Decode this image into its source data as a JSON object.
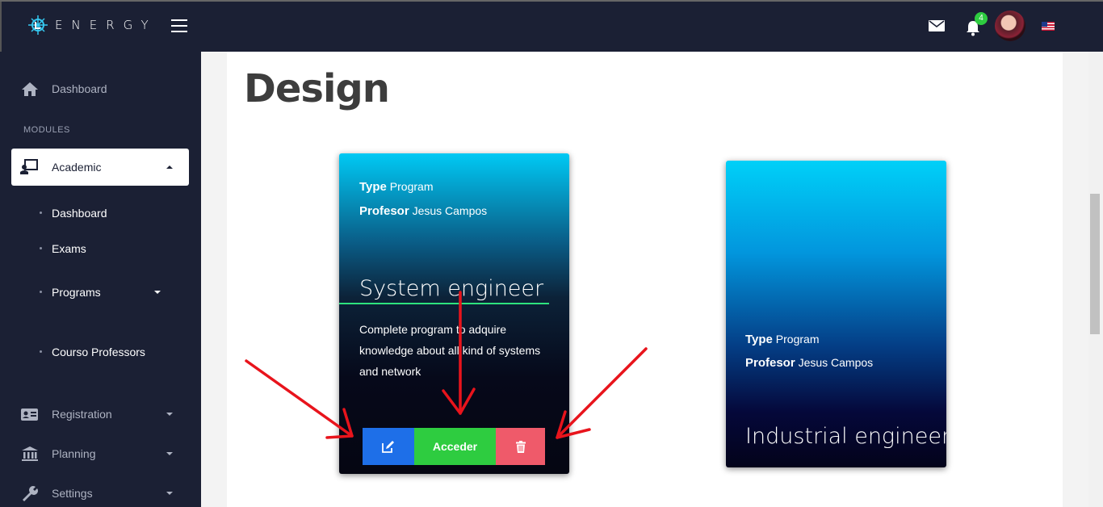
{
  "topbar": {
    "brand": "ENERGY",
    "notification_count": "4"
  },
  "sidebar": {
    "dashboard_label": "Dashboard",
    "modules_header": "MODULES",
    "academic_label": "Academic",
    "academic_subitems": [
      {
        "label": "Dashboard"
      },
      {
        "label": "Exams"
      },
      {
        "label": "Programs"
      },
      {
        "label": "Courso Professors"
      }
    ],
    "registration_label": "Registration",
    "planning_label": "Planning",
    "settings_label": "Settings"
  },
  "main": {
    "page_title": "Design",
    "cards": [
      {
        "type_label": "Type",
        "type_value": "Program",
        "professor_label": "Profesor",
        "professor_value": "Jesus Campos",
        "title": "System engineer",
        "description": "Complete program to adquire knowledge about all kind of systems and network",
        "access_button": "Acceder"
      },
      {
        "type_label": "Type",
        "type_value": "Program",
        "professor_label": "Profesor",
        "professor_value": "Jesus Campos",
        "title": "Industrial engineer"
      }
    ]
  },
  "colors": {
    "sidebar_bg": "#1b2034",
    "edit_button": "#1e6fe8",
    "access_button": "#2ecc40",
    "delete_button": "#ef5a6a",
    "title_underline": "#2ee37e",
    "annotation_arrows": "#e8141c"
  },
  "icons": [
    "logo-icon",
    "menu-icon",
    "mail-icon",
    "bell-icon",
    "flag-icon",
    "home-icon",
    "academic-icon",
    "id-card-icon",
    "bank-icon",
    "wrench-icon",
    "edit-icon",
    "trash-icon"
  ]
}
